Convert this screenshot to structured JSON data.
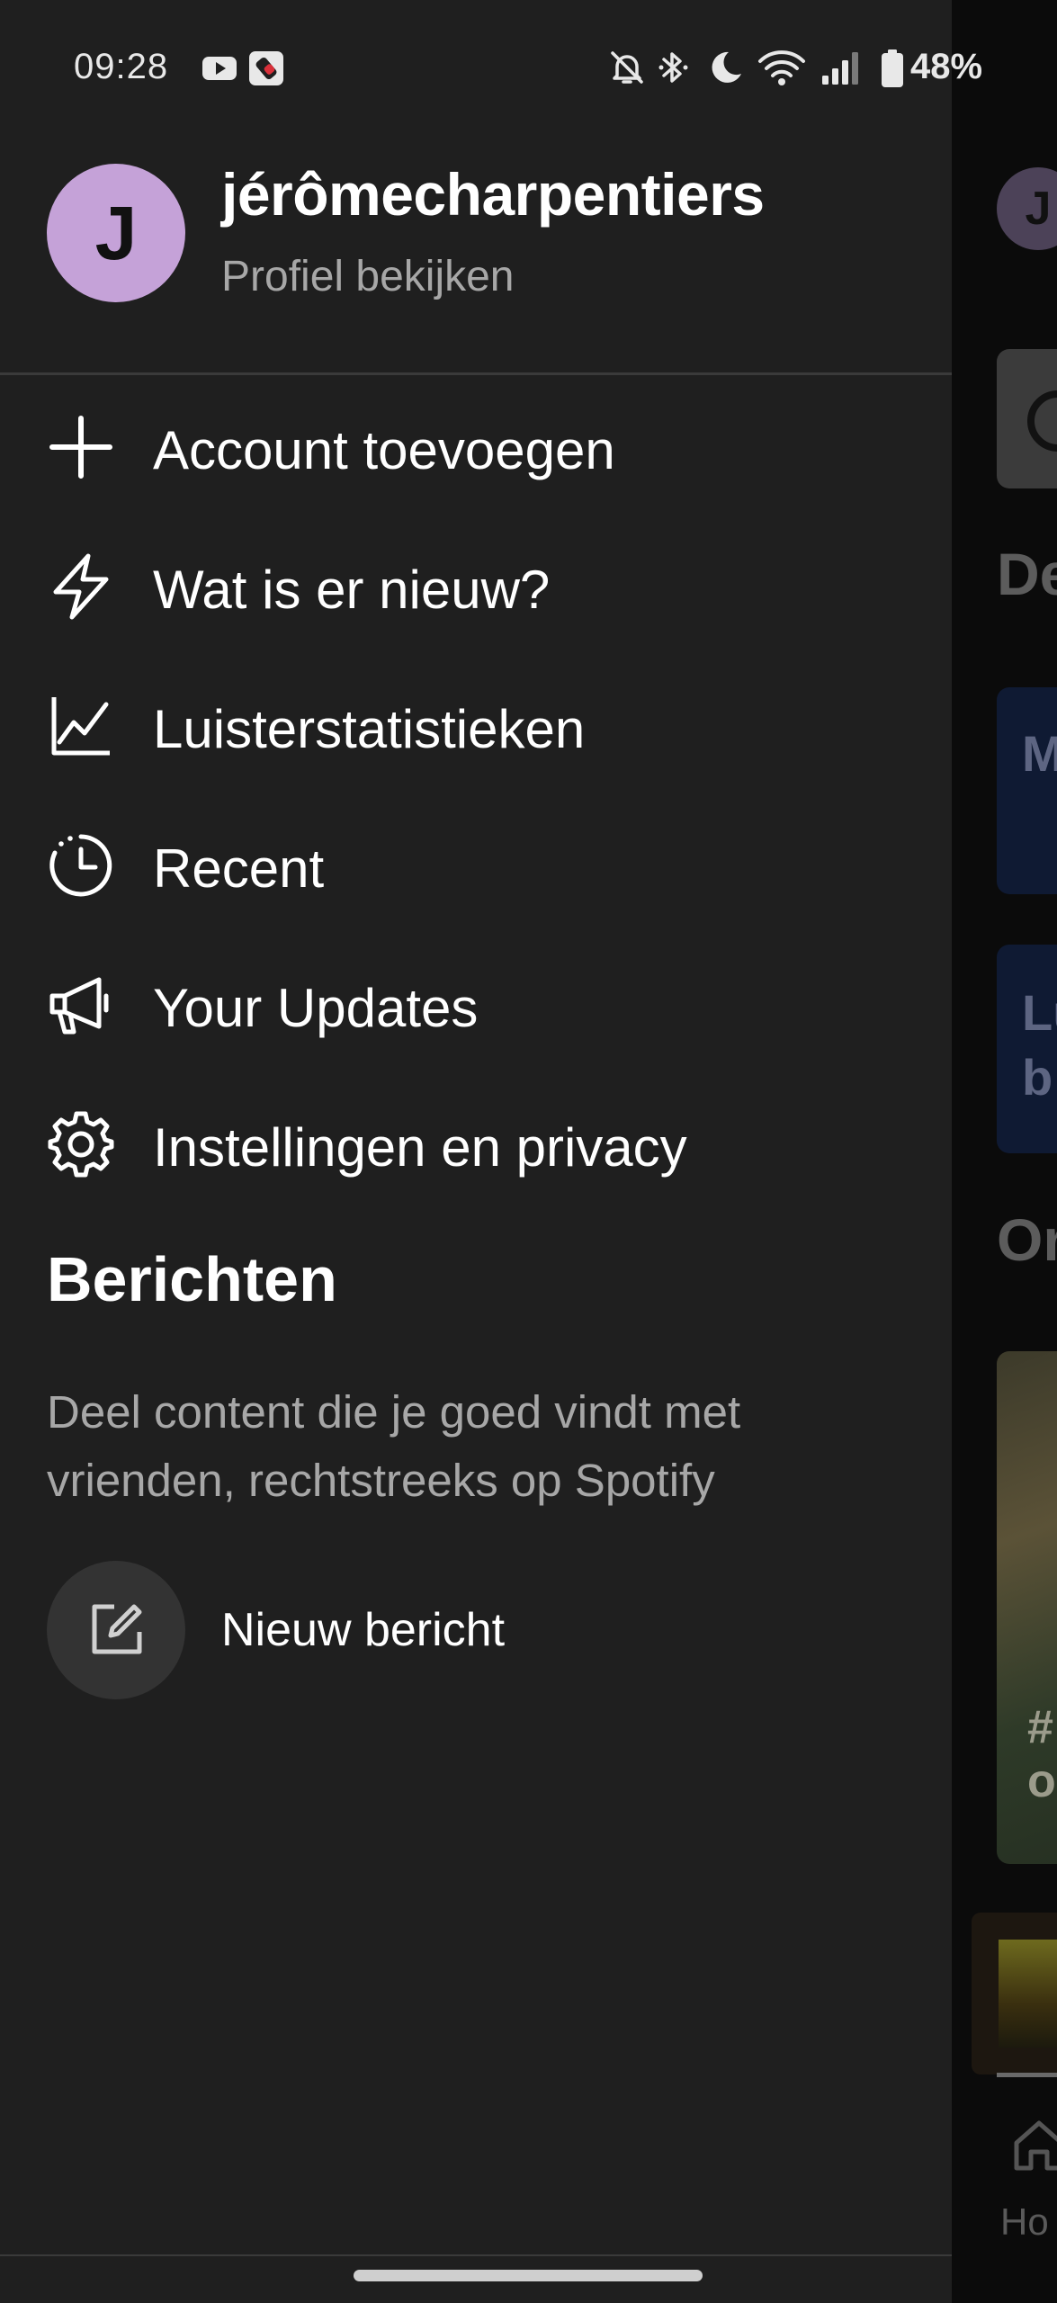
{
  "status_bar": {
    "time": "09:28",
    "battery_percent": "48%",
    "icons": [
      "youtube-icon",
      "screen-record-icon",
      "bell-muted-icon",
      "bluetooth-icon",
      "moon-icon",
      "wifi-icon",
      "signal-icon",
      "battery-icon"
    ]
  },
  "profile": {
    "avatar_letter": "J",
    "username": "jérômecharpentiers",
    "view_profile": "Profiel bekijken"
  },
  "menu": [
    {
      "label": "Account toevoegen",
      "icon": "plus-icon"
    },
    {
      "label": "Wat is er nieuw?",
      "icon": "lightning-icon"
    },
    {
      "label": "Luisterstatistieken",
      "icon": "chart-icon"
    },
    {
      "label": "Recent",
      "icon": "history-icon"
    },
    {
      "label": "Your Updates",
      "icon": "megaphone-icon"
    },
    {
      "label": "Instellingen en privacy",
      "icon": "gear-icon"
    }
  ],
  "messages": {
    "title": "Berichten",
    "description": "Deel content die je goed vindt met vrienden, rechtstreeks op Spotify",
    "new_message": "Nieuw bericht"
  },
  "background": {
    "avatar_letter": "J",
    "heading_1": "De",
    "card_1": "M",
    "card_2_line1": "Lu",
    "card_2_line2": "b",
    "heading_2": "Or",
    "image_text_line1": "#",
    "image_text_line2": "o",
    "nav_home": "Ho"
  },
  "colors": {
    "drawer_bg": "#1f1f1f",
    "avatar_bg": "#c5a2d8",
    "secondary_text": "#a7a7a7"
  }
}
